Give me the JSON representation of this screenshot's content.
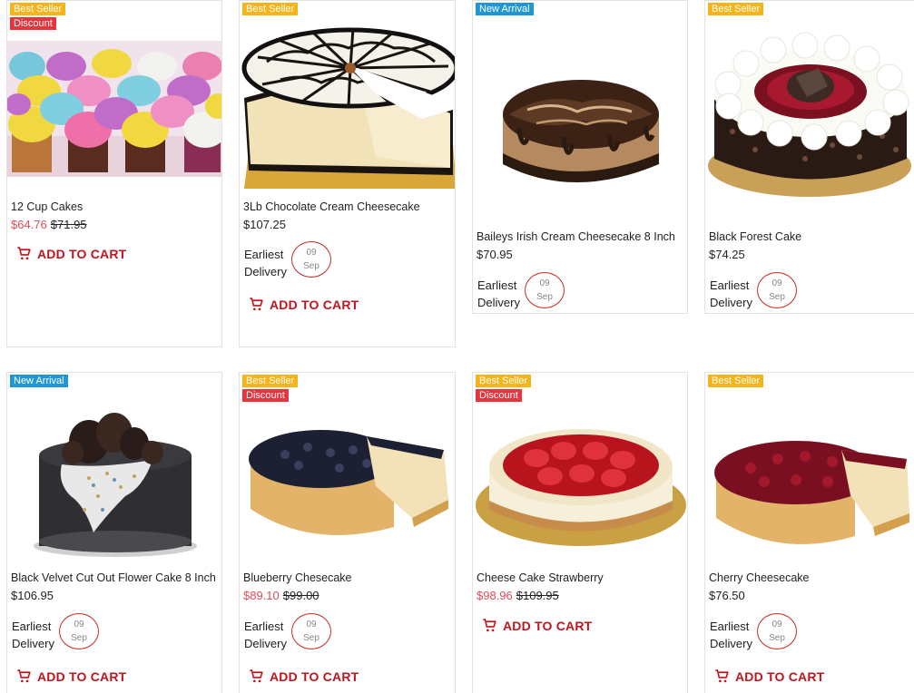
{
  "delivery_label_1": "Earliest",
  "delivery_label_2": "Delivery",
  "products": [
    {
      "name": "12 Cup Cakes",
      "price": "$64.76",
      "old_price": "$71.95",
      "badges": [
        "Best Seller",
        "Discount"
      ],
      "cart_label": "ADD TO CART"
    },
    {
      "name": "3Lb Chocolate Cream Cheesecake",
      "price": "$107.25",
      "old_price": "",
      "badges": [
        "Best Seller"
      ],
      "delivery_day": "09",
      "delivery_month": "Sep",
      "cart_label": "ADD TO CART"
    },
    {
      "name": "Baileys Irish Cream Cheesecake 8 Inch",
      "price": "$70.95",
      "old_price": "",
      "badges": [
        "New Arrival"
      ],
      "delivery_day": "09",
      "delivery_month": "Sep"
    },
    {
      "name": "Black Forest Cake",
      "price": "$74.25",
      "old_price": "",
      "badges": [
        "Best Seller"
      ],
      "delivery_day": "09",
      "delivery_month": "Sep"
    },
    {
      "name": "Black Velvet Cut Out Flower Cake 8 Inch",
      "price": "$106.95",
      "old_price": "",
      "badges": [
        "New Arrival"
      ],
      "delivery_day": "09",
      "delivery_month": "Sep",
      "cart_label": "ADD TO CART"
    },
    {
      "name": "Blueberry Chesecake",
      "price": "$89.10",
      "old_price": "$99.00",
      "badges": [
        "Best Seller",
        "Discount"
      ],
      "delivery_day": "09",
      "delivery_month": "Sep",
      "cart_label": "ADD TO CART"
    },
    {
      "name": "Cheese Cake Strawberry",
      "price": "$98.96",
      "old_price": "$109.95",
      "badges": [
        "Best Seller",
        "Discount"
      ],
      "cart_label": "ADD TO CART"
    },
    {
      "name": "Cherry Cheesecake",
      "price": "$76.50",
      "old_price": "",
      "badges": [
        "Best Seller"
      ],
      "delivery_day": "09",
      "delivery_month": "Sep",
      "cart_label": "ADD TO CART"
    }
  ],
  "colors": {
    "best_seller": "#f6b41b",
    "discount": "#e7343d",
    "new_arrival": "#2196d4",
    "sale_price": "#e14b57",
    "cart": "#c0141c"
  }
}
